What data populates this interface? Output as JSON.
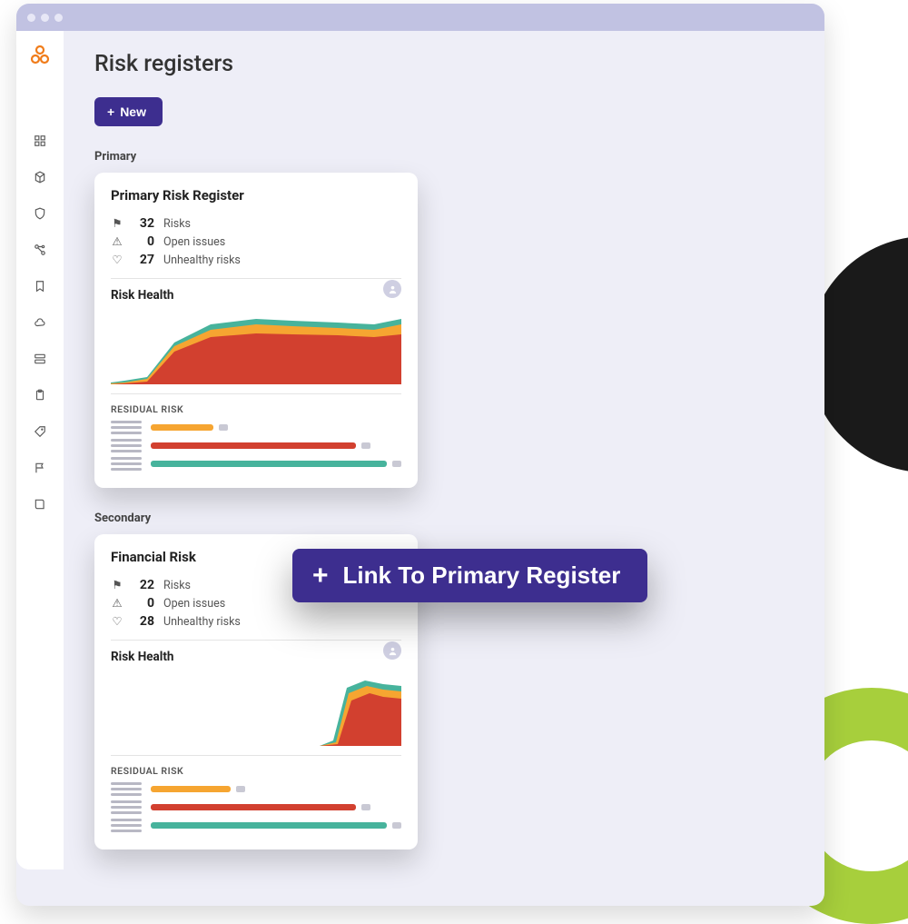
{
  "page": {
    "title": "Risk registers",
    "new_button_label": "New"
  },
  "sections": {
    "primary_label": "Primary",
    "secondary_label": "Secondary"
  },
  "cards": {
    "primary": {
      "title": "Primary Risk Register",
      "risks_count": "32",
      "risks_label": "Risks",
      "open_issues_count": "0",
      "open_issues_label": "Open issues",
      "unhealthy_count": "27",
      "unhealthy_label": "Unhealthy risks",
      "health_title": "Risk Health",
      "residual_title": "RESIDUAL RISK"
    },
    "secondary": {
      "title": "Financial Risk",
      "risks_count": "22",
      "risks_label": "Risks",
      "open_issues_count": "0",
      "open_issues_label": "Open issues",
      "unhealthy_count": "28",
      "unhealthy_label": "Unhealthy risks",
      "health_title": "Risk Health",
      "residual_title": "RESIDUAL RISK"
    }
  },
  "link_button": {
    "label": "Link To Primary Register"
  },
  "colors": {
    "purple": "#3d2e8f",
    "orange": "#f28a1a",
    "red": "#d2402f",
    "teal": "#47b39c",
    "amber": "#f6a531",
    "lime": "#a7cf3c"
  },
  "chart_data": [
    {
      "type": "area",
      "title": "Risk Health (Primary)",
      "xlabel": "",
      "ylabel": "",
      "x": [
        0,
        1,
        2,
        3,
        4,
        5,
        6,
        7,
        8,
        9,
        10
      ],
      "series": [
        {
          "name": "teal",
          "color": "#47b39c",
          "values": [
            2,
            3,
            6,
            40,
            62,
            72,
            70,
            70,
            70,
            68,
            72
          ]
        },
        {
          "name": "orange",
          "color": "#f6a531",
          "values": [
            1,
            2,
            5,
            36,
            56,
            66,
            64,
            63,
            62,
            60,
            64
          ]
        },
        {
          "name": "red",
          "color": "#d2402f",
          "values": [
            0,
            1,
            3,
            30,
            50,
            58,
            56,
            55,
            54,
            52,
            55
          ]
        }
      ],
      "ylim": [
        0,
        80
      ]
    },
    {
      "type": "area",
      "title": "Risk Health (Secondary)",
      "xlabel": "",
      "ylabel": "",
      "x": [
        0,
        1,
        2,
        3,
        4,
        5,
        6,
        7,
        8,
        9,
        10
      ],
      "series": [
        {
          "name": "teal",
          "color": "#47b39c",
          "values": [
            0,
            0,
            0,
            0,
            0,
            0,
            0,
            4,
            58,
            66,
            62
          ]
        },
        {
          "name": "orange",
          "color": "#f6a531",
          "values": [
            0,
            0,
            0,
            0,
            0,
            0,
            0,
            3,
            52,
            60,
            56
          ]
        },
        {
          "name": "red",
          "color": "#d2402f",
          "values": [
            0,
            0,
            0,
            0,
            0,
            0,
            0,
            2,
            44,
            52,
            48
          ]
        }
      ],
      "ylim": [
        0,
        80
      ]
    },
    {
      "type": "bar",
      "title": "RESIDUAL RISK (Primary)",
      "categories": [
        "row1",
        "row2",
        "row3"
      ],
      "series": [
        {
          "name": "segment1",
          "colors": [
            "#f6a531",
            "#d2402f",
            "#47b39c"
          ],
          "values": [
            25,
            82,
            98
          ]
        }
      ],
      "xlabel": "",
      "ylabel": "",
      "ylim": [
        0,
        100
      ]
    },
    {
      "type": "bar",
      "title": "RESIDUAL RISK (Secondary)",
      "categories": [
        "row1",
        "row2",
        "row3"
      ],
      "series": [
        {
          "name": "segment1",
          "colors": [
            "#f6a531",
            "#d2402f",
            "#47b39c"
          ],
          "values": [
            32,
            82,
            98
          ]
        }
      ],
      "xlabel": "",
      "ylabel": "",
      "ylim": [
        0,
        100
      ]
    }
  ]
}
